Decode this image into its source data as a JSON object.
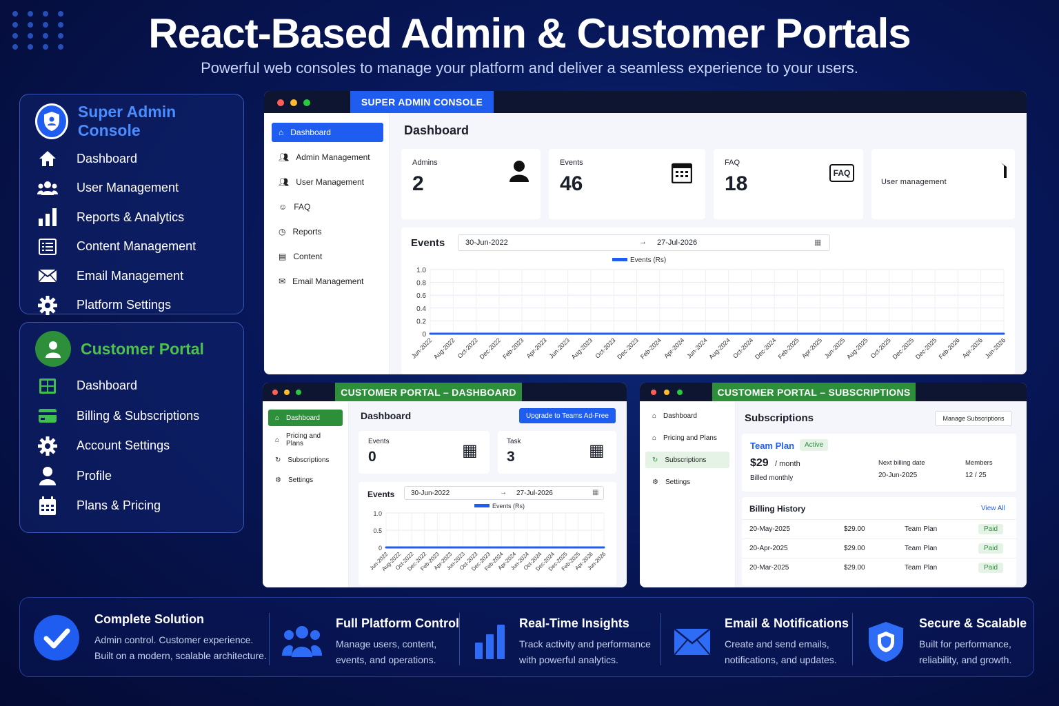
{
  "hero": {
    "title": "React-Based Admin & Customer Portals",
    "subtitle": "Powerful web consoles to manage your platform and deliver a seamless experience to your users."
  },
  "admin_panel": {
    "title": "Super Admin Console",
    "items": [
      {
        "label": "Dashboard",
        "icon": "home-icon"
      },
      {
        "label": "User Management",
        "icon": "users-icon"
      },
      {
        "label": "Reports & Analytics",
        "icon": "bar-chart-icon"
      },
      {
        "label": "Content Management",
        "icon": "list-icon"
      },
      {
        "label": "Email Management",
        "icon": "mail-icon"
      },
      {
        "label": "Platform Settings",
        "icon": "gear-icon"
      }
    ]
  },
  "customer_panel": {
    "title": "Customer Portal",
    "items": [
      {
        "label": "Dashboard",
        "icon": "grid-icon"
      },
      {
        "label": "Billing & Subscriptions",
        "icon": "card-icon"
      },
      {
        "label": "Account Settings",
        "icon": "gear-icon"
      },
      {
        "label": "Profile",
        "icon": "user-icon"
      },
      {
        "label": "Plans & Pricing",
        "icon": "calendar-icon"
      }
    ]
  },
  "admin_window": {
    "tab": "SUPER ADMIN CONSOLE",
    "sidebar": [
      "Dashboard",
      "Admin Management",
      "User Management",
      "FAQ",
      "Reports",
      "Content",
      "Email Management"
    ],
    "page_title": "Dashboard",
    "stats": [
      {
        "label": "Admins",
        "value": "2"
      },
      {
        "label": "Events",
        "value": "46"
      },
      {
        "label": "FAQ",
        "value": "18"
      },
      {
        "label": "",
        "value": "User management"
      }
    ],
    "faq_icon_text": "FAQ",
    "events_title": "Events",
    "date_from": "30-Jun-2022",
    "date_to": "27-Jul-2026",
    "arrow": "→",
    "legend": "Events (Rs)",
    "y_ticks": [
      "1.0",
      "0.8",
      "0.6",
      "0.4",
      "0.2",
      "0"
    ],
    "x_ticks": [
      "Jun-2022",
      "Aug-2022",
      "Oct-2022",
      "Dec-2022",
      "Feb-2023",
      "Apr-2023",
      "Jun-2023",
      "Aug-2023",
      "Oct-2023",
      "Dec-2023",
      "Feb-2024",
      "Apr-2024",
      "Jun-2024",
      "Aug-2024",
      "Oct-2024",
      "Dec-2024",
      "Feb-2025",
      "Apr-2025",
      "Jun-2025",
      "Aug-2025",
      "Oct-2025",
      "Dec-2025",
      "Dec-2025",
      "Feb-2026",
      "Apr-2026",
      "Jun-2026"
    ]
  },
  "cust_dash_window": {
    "tab": "CUSTOMER PORTAL – DASHBOARD",
    "sidebar": [
      "Dashboard",
      "Pricing and Plans",
      "Subscriptions",
      "Settings"
    ],
    "page_title": "Dashboard",
    "upgrade_label": "Upgrade to Teams Ad-Free",
    "stats": [
      {
        "label": "Events",
        "value": "0"
      },
      {
        "label": "Task",
        "value": "3"
      }
    ],
    "events_title": "Events",
    "date_from": "30-Jun-2022",
    "date_to": "27-Jul-2026",
    "arrow": "→",
    "legend": "Events (Rs)",
    "y_ticks": [
      "1.0",
      "0.5",
      "0"
    ],
    "x_ticks": [
      "Jun-2022",
      "Aug-2022",
      "Oct-2022",
      "Dec-2022",
      "Feb-2023",
      "Apr-2023",
      "Jun-2023",
      "Oct-2023",
      "Dec-2023",
      "Feb-2024",
      "Apr-2024",
      "Jun-2024",
      "Oct-2024",
      "Dec-2024",
      "Dec-2025",
      "Feb-2025",
      "Apr-2026",
      "Jun-2026"
    ]
  },
  "cust_subs_window": {
    "tab": "CUSTOMER PORTAL – SUBSCRIPTIONS",
    "sidebar": [
      "Dashboard",
      "Pricing and Plans",
      "Subscriptions",
      "Settings"
    ],
    "page_title": "Subscriptions",
    "manage_label": "Manage Subscriptions",
    "plan_name": "Team Plan",
    "plan_status": "Active",
    "price": "$29",
    "per": "/ month",
    "billed": "Billed monthly",
    "next_billing_label": "Next billing date",
    "next_billing_value": "20-Jun-2025",
    "members_label": "Members",
    "members_value": "12 / 25",
    "history_title": "Billing History",
    "view_all": "View All",
    "history": [
      {
        "date": "20-May-2025",
        "amount": "$29.00",
        "plan": "Team Plan",
        "status": "Paid"
      },
      {
        "date": "20-Apr-2025",
        "amount": "$29.00",
        "plan": "Team Plan",
        "status": "Paid"
      },
      {
        "date": "20-Mar-2025",
        "amount": "$29.00",
        "plan": "Team Plan",
        "status": "Paid"
      }
    ]
  },
  "chart_data": [
    {
      "type": "line",
      "title": "Events",
      "legend": [
        "Events (Rs)"
      ],
      "x": [
        "Jun-2022",
        "Aug-2022",
        "Oct-2022",
        "Dec-2022",
        "Feb-2023",
        "Apr-2023",
        "Jun-2023",
        "Aug-2023",
        "Oct-2023",
        "Dec-2023",
        "Feb-2024",
        "Apr-2024",
        "Jun-2024",
        "Aug-2024",
        "Oct-2024",
        "Dec-2024",
        "Feb-2025",
        "Apr-2025",
        "Jun-2025",
        "Aug-2025",
        "Oct-2025",
        "Dec-2025",
        "Dec-2025",
        "Feb-2026",
        "Apr-2026",
        "Jun-2026"
      ],
      "series": [
        {
          "name": "Events (Rs)",
          "values": [
            0,
            0,
            0,
            0,
            0,
            0,
            0,
            0,
            0,
            0,
            0,
            0,
            0,
            0,
            0,
            0,
            0,
            0,
            0,
            0,
            0,
            0,
            0,
            0,
            0,
            0
          ]
        }
      ],
      "ylim": [
        0,
        1.0
      ],
      "grid": true
    },
    {
      "type": "line",
      "title": "Events",
      "legend": [
        "Events (Rs)"
      ],
      "x": [
        "Jun-2022",
        "Aug-2022",
        "Oct-2022",
        "Dec-2022",
        "Feb-2023",
        "Apr-2023",
        "Jun-2023",
        "Oct-2023",
        "Dec-2023",
        "Feb-2024",
        "Apr-2024",
        "Jun-2024",
        "Oct-2024",
        "Dec-2024",
        "Dec-2025",
        "Feb-2025",
        "Apr-2026",
        "Jun-2026"
      ],
      "series": [
        {
          "name": "Events (Rs)",
          "values": [
            0,
            0,
            0,
            0,
            0,
            0,
            0,
            0,
            0,
            0,
            0,
            0,
            0,
            0,
            0,
            0,
            0,
            0
          ]
        }
      ],
      "ylim": [
        0,
        1.0
      ],
      "grid": true
    }
  ],
  "features": [
    {
      "title": "Complete Solution",
      "line1": "Admin control. Customer experience.",
      "line2": "Built on a modern, scalable architecture.",
      "icon": "check-circle-icon"
    },
    {
      "title": "Full Platform Control",
      "line1": "Manage users, content,",
      "line2": "events, and operations.",
      "icon": "users-icon"
    },
    {
      "title": "Real-Time Insights",
      "line1": "Track activity and performance",
      "line2": "with powerful analytics.",
      "icon": "bar-chart-icon"
    },
    {
      "title": "Email & Notifications",
      "line1": "Create and send emails,",
      "line2": "notifications, and updates.",
      "icon": "mail-icon"
    },
    {
      "title": "Secure & Scalable",
      "line1": "Built for performance,",
      "line2": "reliability, and growth.",
      "icon": "shield-icon"
    }
  ],
  "colors": {
    "accent_blue": "#1f5df0",
    "accent_green": "#2e8f3a",
    "admin_title": "#4a8dff",
    "customer_title": "#4cc24c"
  }
}
